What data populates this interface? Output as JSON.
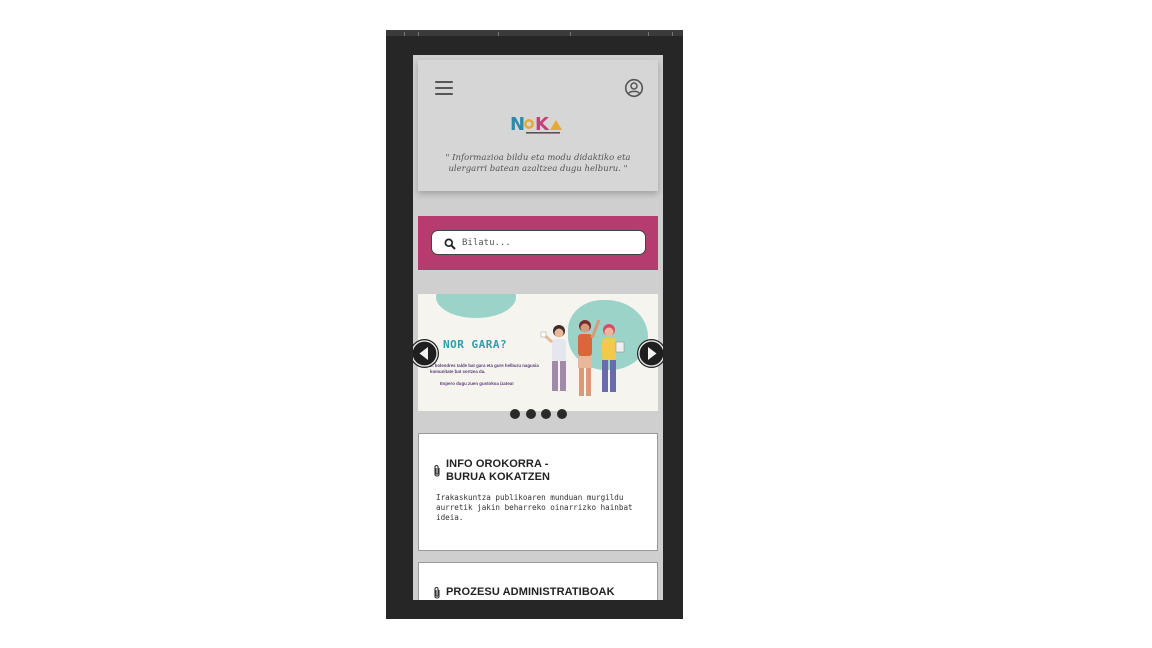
{
  "header": {
    "tagline": "\" Informazioa bildu eta modu didaktiko eta ulergarri batean azaltzea dugu helburu. \"",
    "logo_text": "NOKA"
  },
  "search": {
    "placeholder": "Bilatu..."
  },
  "carousel": {
    "slide_title": "NOR GARA?",
    "slide_text": "... kolendres talde bat gara eta gure helburu nagusia komunitate bat sortzea da.",
    "slide_text2": "Espero dugu zuen gustokoa izatea!",
    "dot_count": 4
  },
  "cards": [
    {
      "title_line1": "INFO OROKORRA -",
      "title_line2": "BURUA KOKATZEN",
      "description": "Irakaskuntza publikoaren munduan murgildu aurretik jakin beharreko oinarrizko hainbat ideia."
    },
    {
      "title_line1": "PROZESU ADMINISTRATIBOAK"
    }
  ],
  "colors": {
    "accent_pink": "#b63c70",
    "teal": "#2f9db0",
    "background_gray": "#cfcfcf"
  },
  "icons": {
    "menu": "hamburger-icon",
    "account": "account-circle-icon",
    "search": "search-icon",
    "prev": "chevron-left-icon",
    "next": "chevron-right-icon",
    "card": "paperclip-icon"
  }
}
